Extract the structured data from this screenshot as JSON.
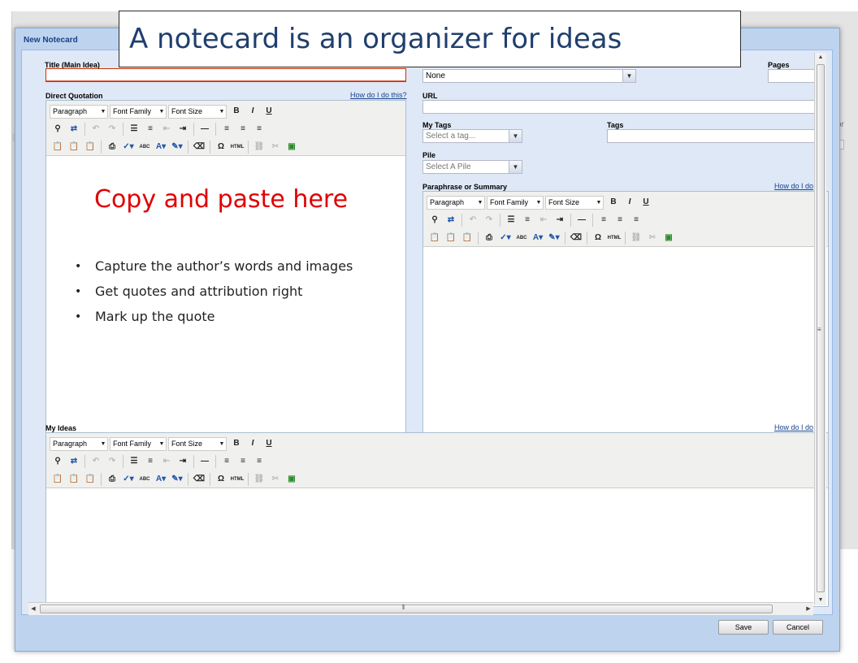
{
  "banner": {
    "text": "A notecard is an organizer for ideas"
  },
  "background": {
    "fragment": "or"
  },
  "dialog": {
    "title": "New Notecard",
    "title_field": {
      "label": "Title (Main Idea)",
      "value": ""
    },
    "source_select": {
      "value": "None"
    },
    "pages": {
      "label": "Pages",
      "value": ""
    },
    "direct_quotation": {
      "label": "Direct Quotation",
      "help_link": "How do I do this?"
    },
    "url": {
      "label": "URL",
      "value": ""
    },
    "my_tags": {
      "label": "My Tags",
      "placeholder": "Select a tag..."
    },
    "tags": {
      "label": "Tags",
      "value": ""
    },
    "pile": {
      "label": "Pile",
      "placeholder": "Select A Pile"
    },
    "paraphrase": {
      "label": "Paraphrase or Summary",
      "help_link": "How do I do"
    },
    "my_ideas": {
      "label": "My Ideas",
      "help_link": "How do I do"
    },
    "save_label": "Save",
    "cancel_label": "Cancel"
  },
  "toolbar": {
    "format": "Paragraph",
    "font_family": "Font Family",
    "font_size": "Font Size",
    "bold": "B",
    "italic": "I",
    "underline": "U",
    "abc": "ABC",
    "html": "HTML",
    "omega": "Ω"
  },
  "overlay": {
    "headline": "Copy and paste here",
    "bullets": [
      "Capture the author’s words and images",
      "Get quotes and attribution right",
      "Mark up the quote"
    ]
  },
  "icons": {
    "find": "find-icon",
    "replace": "replace-icon",
    "undo": "undo-icon",
    "redo": "redo-icon",
    "bullet_list": "bullet-list-icon",
    "numbered_list": "numbered-list-icon",
    "outdent": "outdent-icon",
    "indent": "indent-icon",
    "hr": "horizontal-rule-icon",
    "align_left": "align-left-icon",
    "align_center": "align-center-icon",
    "align_right": "align-right-icon",
    "paste": "paste-icon",
    "paste_text": "paste-text-icon",
    "paste_word": "paste-word-icon",
    "print": "print-icon",
    "spellcheck": "spellcheck-icon",
    "strike": "strikethrough-icon",
    "forecolor": "text-color-icon",
    "backcolor": "highlight-color-icon",
    "cleanup": "cleanup-icon",
    "charmap": "special-char-icon",
    "link": "link-icon",
    "unlink": "unlink-icon",
    "image": "image-icon"
  },
  "colors": {
    "dialog_frame": "#bed3ee",
    "dialog_body": "#dfe8f6",
    "dialog_title": "#15428b",
    "banner_text": "#1f3f6e",
    "overlay_red": "#e00000",
    "invalid_border": "#cc3300"
  }
}
